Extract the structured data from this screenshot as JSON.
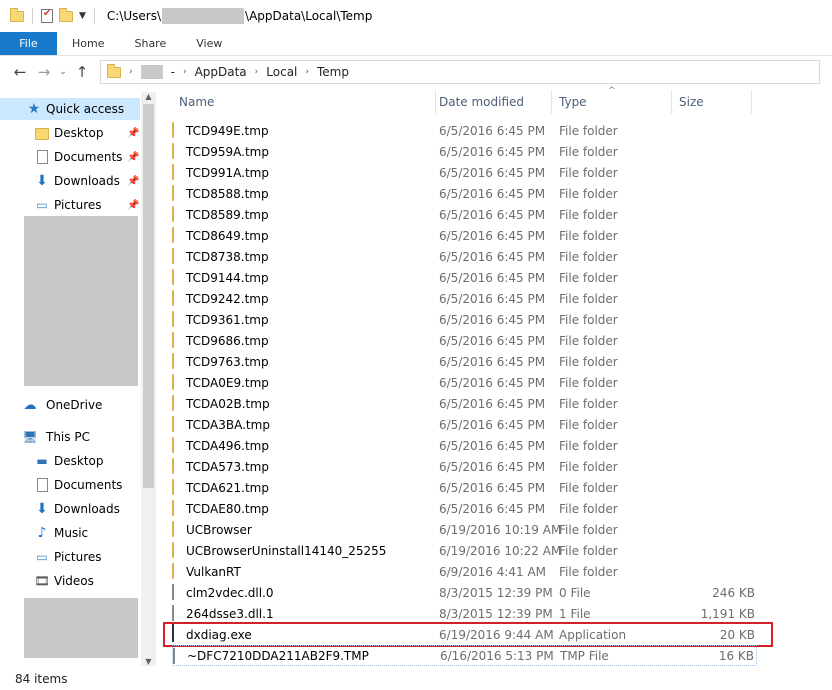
{
  "titlebar": {
    "path_prefix": "C:\\Users\\",
    "path_suffix": "\\AppData\\Local\\Temp"
  },
  "ribbon": {
    "tabs": [
      "File",
      "Home",
      "Share",
      "View"
    ]
  },
  "address": {
    "separator": "-",
    "segments": [
      "AppData",
      "Local",
      "Temp"
    ]
  },
  "nav": {
    "quick_access": "Quick access",
    "quick_items": [
      "Desktop",
      "Documents",
      "Downloads",
      "Pictures"
    ],
    "onedrive": "OneDrive",
    "this_pc": "This PC",
    "pc_items": [
      "Desktop",
      "Documents",
      "Downloads",
      "Music",
      "Pictures",
      "Videos"
    ]
  },
  "columns": {
    "name": "Name",
    "date": "Date modified",
    "type": "Type",
    "size": "Size"
  },
  "files": [
    {
      "name": "TCD949E.tmp",
      "date": "6/5/2016 6:45 PM",
      "type": "File folder",
      "size": "",
      "kind": "folder"
    },
    {
      "name": "TCD959A.tmp",
      "date": "6/5/2016 6:45 PM",
      "type": "File folder",
      "size": "",
      "kind": "folder"
    },
    {
      "name": "TCD991A.tmp",
      "date": "6/5/2016 6:45 PM",
      "type": "File folder",
      "size": "",
      "kind": "folder"
    },
    {
      "name": "TCD8588.tmp",
      "date": "6/5/2016 6:45 PM",
      "type": "File folder",
      "size": "",
      "kind": "folder"
    },
    {
      "name": "TCD8589.tmp",
      "date": "6/5/2016 6:45 PM",
      "type": "File folder",
      "size": "",
      "kind": "folder"
    },
    {
      "name": "TCD8649.tmp",
      "date": "6/5/2016 6:45 PM",
      "type": "File folder",
      "size": "",
      "kind": "folder"
    },
    {
      "name": "TCD8738.tmp",
      "date": "6/5/2016 6:45 PM",
      "type": "File folder",
      "size": "",
      "kind": "folder"
    },
    {
      "name": "TCD9144.tmp",
      "date": "6/5/2016 6:45 PM",
      "type": "File folder",
      "size": "",
      "kind": "folder"
    },
    {
      "name": "TCD9242.tmp",
      "date": "6/5/2016 6:45 PM",
      "type": "File folder",
      "size": "",
      "kind": "folder"
    },
    {
      "name": "TCD9361.tmp",
      "date": "6/5/2016 6:45 PM",
      "type": "File folder",
      "size": "",
      "kind": "folder"
    },
    {
      "name": "TCD9686.tmp",
      "date": "6/5/2016 6:45 PM",
      "type": "File folder",
      "size": "",
      "kind": "folder"
    },
    {
      "name": "TCD9763.tmp",
      "date": "6/5/2016 6:45 PM",
      "type": "File folder",
      "size": "",
      "kind": "folder"
    },
    {
      "name": "TCDA0E9.tmp",
      "date": "6/5/2016 6:45 PM",
      "type": "File folder",
      "size": "",
      "kind": "folder"
    },
    {
      "name": "TCDA02B.tmp",
      "date": "6/5/2016 6:45 PM",
      "type": "File folder",
      "size": "",
      "kind": "folder"
    },
    {
      "name": "TCDA3BA.tmp",
      "date": "6/5/2016 6:45 PM",
      "type": "File folder",
      "size": "",
      "kind": "folder"
    },
    {
      "name": "TCDA496.tmp",
      "date": "6/5/2016 6:45 PM",
      "type": "File folder",
      "size": "",
      "kind": "folder"
    },
    {
      "name": "TCDA573.tmp",
      "date": "6/5/2016 6:45 PM",
      "type": "File folder",
      "size": "",
      "kind": "folder"
    },
    {
      "name": "TCDA621.tmp",
      "date": "6/5/2016 6:45 PM",
      "type": "File folder",
      "size": "",
      "kind": "folder"
    },
    {
      "name": "TCDAE80.tmp",
      "date": "6/5/2016 6:45 PM",
      "type": "File folder",
      "size": "",
      "kind": "folder"
    },
    {
      "name": "UCBrowser",
      "date": "6/19/2016 10:19 AM",
      "type": "File folder",
      "size": "",
      "kind": "folder"
    },
    {
      "name": "UCBrowserUninstall14140_25255",
      "date": "6/19/2016 10:22 AM",
      "type": "File folder",
      "size": "",
      "kind": "folder"
    },
    {
      "name": "VulkanRT",
      "date": "6/9/2016 4:41 AM",
      "type": "File folder",
      "size": "",
      "kind": "folder"
    },
    {
      "name": "clm2vdec.dll.0",
      "date": "8/3/2015 12:39 PM",
      "type": "0 File",
      "size": "246 KB",
      "kind": "file"
    },
    {
      "name": "264dsse3.dll.1",
      "date": "8/3/2015 12:39 PM",
      "type": "1 File",
      "size": "1,191 KB",
      "kind": "file"
    },
    {
      "name": "dxdiag.exe",
      "date": "6/19/2016 9:44 AM",
      "type": "Application",
      "size": "20 KB",
      "kind": "exe"
    },
    {
      "name": "~DFC7210DDA211AB2F9.TMP",
      "date": "6/16/2016 5:13 PM",
      "type": "TMP File",
      "size": "16 KB",
      "kind": "file"
    }
  ],
  "status": {
    "item_count": "84 items"
  },
  "colors": {
    "file_tab": "#1979ca",
    "selection": "#cce8ff",
    "highlight_box": "#d42027"
  }
}
